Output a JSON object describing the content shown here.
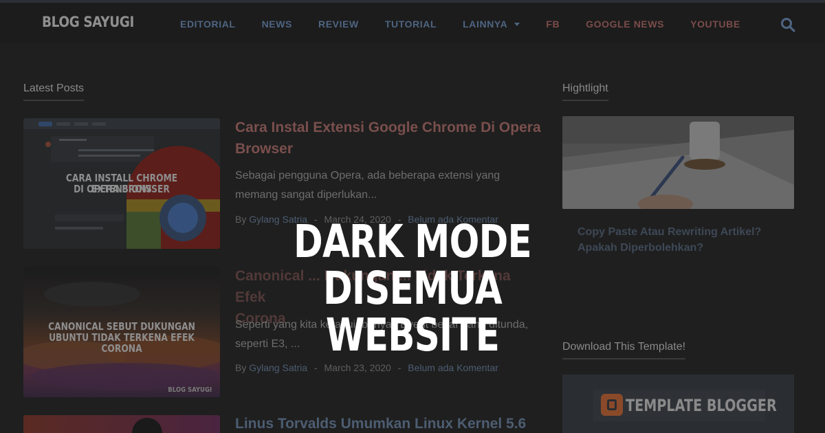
{
  "logo": "BLOG SAYUGI",
  "nav": {
    "items": [
      {
        "label": "EDITORIAL"
      },
      {
        "label": "NEWS"
      },
      {
        "label": "REVIEW"
      },
      {
        "label": "TUTORIAL"
      },
      {
        "label": "LAINNYA"
      },
      {
        "label": "FB"
      },
      {
        "label": "GOOGLE NEWS"
      },
      {
        "label": "YOUTUBE"
      }
    ],
    "search_icon": "search-icon"
  },
  "latest": {
    "title": "Latest Posts",
    "posts": [
      {
        "thumb_caption_1": "CARA INSTALL CHROME EXTENSIONS",
        "thumb_caption_2": "DI OPERA BROWSER",
        "title_line1": "Cara Instal Extensi Google Chrome Di Opera",
        "title_line2": "Browser",
        "excerpt_line1": "Sebagai pengguna Opera, ada beberapa extensi yang",
        "excerpt_line2": "memang sangat diperlukan...",
        "author_prefix": "By",
        "author": "Gylang Satria",
        "date": "March 24, 2020",
        "comments": "Belum ada Komentar"
      },
      {
        "thumb_caption_1": "CANONICAL SEBUT DUKUNGAN",
        "thumb_caption_2": "UBUNTU TIDAK TERKENA EFEK CORONA",
        "thumb_watermark": "BLOG SAYUGI",
        "title_line1": "Canonical ... Dukungan ... Tidak Terkena Efek",
        "title_line2": "Corona",
        "excerpt_line1": "Seperti yang kita ketahui, banyak Event besar yang ditunda,",
        "excerpt_line2": "seperti E3, ...",
        "author_prefix": "By",
        "author": "Gylang Satria",
        "date": "March 23, 2020",
        "comments": "Belum ada Komentar"
      },
      {
        "title_line1": "Linus Torvalds Umumkan Linux Kernel 5.6"
      }
    ]
  },
  "sidebar": {
    "highlight_title": "Hightlight",
    "highlight_post_line1": "Copy Paste Atau Rewriting Artikel?",
    "highlight_post_line2": "Apakah Diperbolehkan?",
    "download_title": "Download This Template!",
    "template_logo_text": "TEMPLATE BLOGGER"
  },
  "overlay": {
    "line1": "DARK MODE",
    "line2": "DISEMUA WEBSITE"
  },
  "colors": {
    "background": "#1f1f1f",
    "nav_link": "#4e6582",
    "nav_link_social": "#7a4c4a",
    "post_title": "#7a4f4d",
    "overlay_text": "#ffffff"
  }
}
